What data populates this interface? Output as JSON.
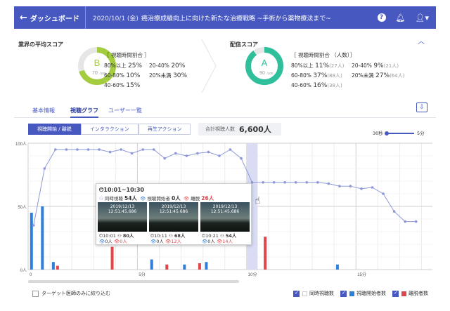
{
  "header": {
    "back_label": "ダッシュボード",
    "date": "2020/10/1 (金)",
    "title": "癌治療成績向上に向けた新たな治療戦略 ~手術から薬物療法まで~"
  },
  "industry_score": {
    "title": "業界の平均スコア",
    "grade": "B",
    "score": "70",
    "max": "/100",
    "ratio_title": "［ 視聴時間割合 ］",
    "rows": [
      {
        "label": "80%以上",
        "value": "25%"
      },
      {
        "label": "20-40%",
        "value": "20%"
      },
      {
        "label": "60-80%",
        "value": "10%"
      },
      {
        "label": "20%未満",
        "value": "30%"
      },
      {
        "label": "40-60%",
        "value": "15%"
      }
    ]
  },
  "delivery_score": {
    "title": "配信スコア",
    "grade": "A",
    "score": "90",
    "max": "/100",
    "ratio_title": "［ 視聴時間割合 （人数）］",
    "rows": [
      {
        "label": "80%以上",
        "value": "11%",
        "sub": "(27人)"
      },
      {
        "label": "20-40%",
        "value": "9%",
        "sub": "(21人)"
      },
      {
        "label": "60-80%",
        "value": "37%",
        "sub": "(88人)"
      },
      {
        "label": "20%未満",
        "value": "27%",
        "sub": "(64人)"
      },
      {
        "label": "40-60%",
        "value": "16%",
        "sub": "(38人)"
      }
    ]
  },
  "tabs": [
    "基本情報",
    "視聴グラフ",
    "ユーザー一覧"
  ],
  "active_tab": 1,
  "controls": {
    "buttons": [
      "視聴開始 / 離脱",
      "インタラクション",
      "再生アクション"
    ],
    "active": 0,
    "total_label": "合計視聴人数",
    "total_value": "6,600人",
    "speed_min": "30秒",
    "speed_max": "5分"
  },
  "chart_data": {
    "type": "bar",
    "y_ticks": [
      "100人",
      "50人",
      "0人"
    ],
    "x_ticks": [
      "0",
      "5分",
      "10分",
      "15分"
    ],
    "ylim": [
      0,
      100
    ],
    "x": [
      0.25,
      0.75,
      1.25,
      1.75,
      2.25,
      2.75,
      3.25,
      3.75,
      4.25,
      4.75,
      5.25,
      5.75,
      6.25,
      6.75,
      7.25,
      7.75,
      8.25,
      8.75,
      9.25,
      9.75,
      10.25,
      10.75,
      11.25,
      11.75,
      12.25,
      12.75,
      13.25,
      13.75,
      14.25,
      14.75,
      15.25,
      15.75,
      16.25,
      16.75,
      17.25,
      17.75
    ],
    "series": [
      {
        "name": "同時視聴数",
        "values": [
          35,
          80,
          95,
          95,
          95,
          95,
          95,
          93,
          95,
          92,
          95,
          95,
          88,
          92,
          90,
          92,
          93,
          90,
          95,
          88,
          69,
          69,
          69,
          69,
          69,
          69,
          69,
          68,
          66,
          66,
          64,
          65,
          60,
          46,
          38,
          38
        ]
      },
      {
        "name": "視聴開始者数",
        "values": [
          45,
          50,
          6,
          0,
          0,
          0,
          0,
          0,
          0,
          0,
          0,
          8,
          0,
          0,
          4,
          0,
          6,
          0,
          0,
          0,
          0,
          0,
          0,
          0,
          0,
          0,
          0,
          0,
          4,
          0,
          0,
          0,
          0,
          0,
          0,
          0
        ]
      },
      {
        "name": "離脱者数",
        "values": [
          0,
          0,
          3,
          0,
          0,
          0,
          0,
          18,
          0,
          0,
          0,
          0,
          4,
          0,
          0,
          5,
          0,
          0,
          0,
          0,
          0,
          26,
          0,
          0,
          0,
          0,
          0,
          0,
          0,
          0,
          0,
          0,
          0,
          0,
          0,
          0
        ]
      }
    ]
  },
  "popup": {
    "time": "10:01~10:30",
    "concurrent_label": "同時視聴",
    "concurrent": "54人",
    "start_label": "視聴開始者",
    "start": "0人",
    "leave_label": "離脱",
    "leave": "26人",
    "thumbs": [
      {
        "date": "2019/12/13",
        "clock": "12:51:45.686",
        "time": "10:01",
        "viewers": "80人",
        "start": "0人",
        "leave": "0人"
      },
      {
        "date": "2019/12/13",
        "clock": "12:51:45.686",
        "time": "10:11",
        "viewers": "68人",
        "start": "0人",
        "leave": "12人"
      },
      {
        "date": "2019/12/13",
        "clock": "12:51:45.686",
        "time": "10:21",
        "viewers": "54人",
        "start": "0人",
        "leave": "14人"
      }
    ]
  },
  "footer": {
    "filter_label": "ターゲット医師のみに絞り込む",
    "legend": [
      "同時視聴数",
      "視聴開始者数",
      "離脱者数"
    ]
  },
  "colors": {
    "primary": "#4759c0",
    "grade_b": "#a3cc3f",
    "grade_a": "#2fbf9b",
    "line": "#8e98d8",
    "bar_start": "#2f7fd8",
    "bar_leave": "#e0474c",
    "highlight": "#d9dcf2"
  }
}
